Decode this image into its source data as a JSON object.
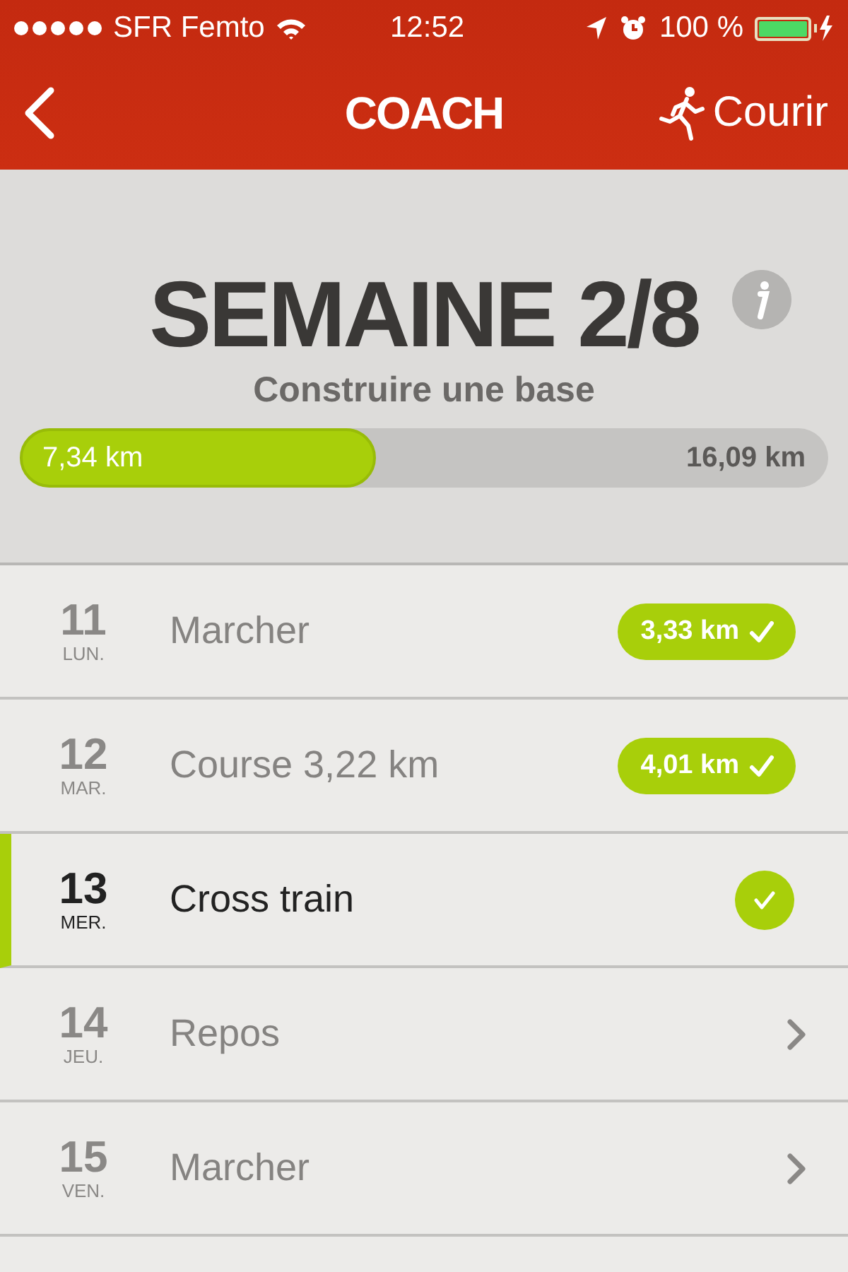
{
  "status_bar": {
    "carrier": "SFR Femto",
    "time": "12:52",
    "battery": "100 %"
  },
  "nav": {
    "title": "COACH",
    "action": "Courir"
  },
  "header": {
    "title": "SEMAINE 2/8",
    "subtitle": "Construire une base",
    "progress": {
      "level": 0.44,
      "done": "7,34 km",
      "total": "16,09 km"
    }
  },
  "days": [
    {
      "day": "11",
      "weekday": "LUN.",
      "activity": "Marcher",
      "kind": "badge",
      "badge": "3,33 km",
      "selected": false
    },
    {
      "day": "12",
      "weekday": "MAR.",
      "activity": "Course 3,22 km",
      "kind": "badge",
      "badge": "4,01 km",
      "selected": false
    },
    {
      "day": "13",
      "weekday": "MER.",
      "activity": "Cross train",
      "kind": "done",
      "selected": true
    },
    {
      "day": "14",
      "weekday": "JEU.",
      "activity": "Repos",
      "kind": "pending",
      "selected": false
    },
    {
      "day": "15",
      "weekday": "VEN.",
      "activity": "Marcher",
      "kind": "pending",
      "selected": false
    }
  ]
}
